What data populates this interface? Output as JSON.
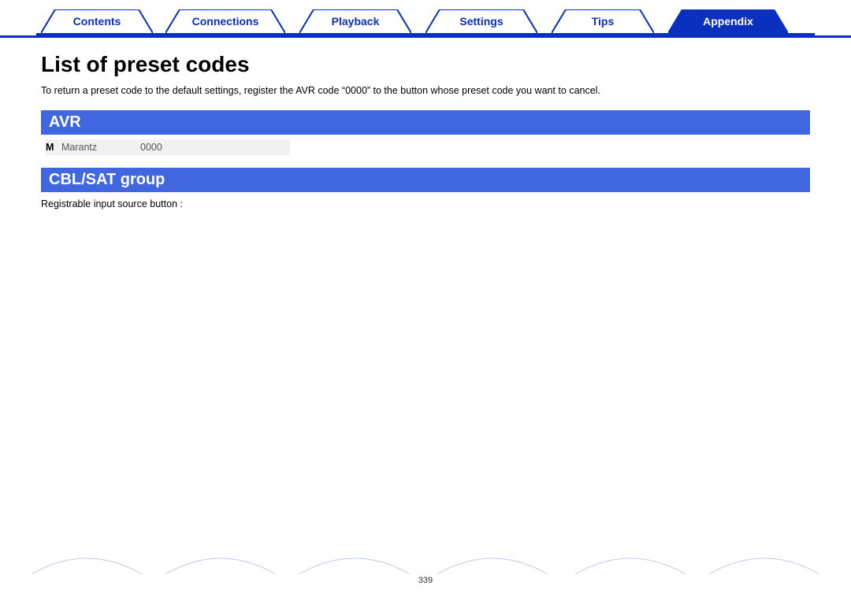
{
  "nav": {
    "tabs": [
      {
        "label": "Contents"
      },
      {
        "label": "Connections"
      },
      {
        "label": "Playback"
      },
      {
        "label": "Settings"
      },
      {
        "label": "Tips"
      },
      {
        "label": "Appendix"
      }
    ],
    "active_index": 5
  },
  "page": {
    "title": "List of preset codes",
    "intro": "To return a preset code to the default settings, register the AVR code “0000” to the button whose preset code you want to cancel.",
    "page_number": "339"
  },
  "sections": {
    "avr": {
      "heading": "AVR",
      "rows": [
        {
          "letter": "M",
          "brand": "Marantz",
          "code": "0000"
        }
      ]
    },
    "cblsat": {
      "heading": "CBL/SAT group",
      "note": "Registrable input source button :"
    }
  }
}
